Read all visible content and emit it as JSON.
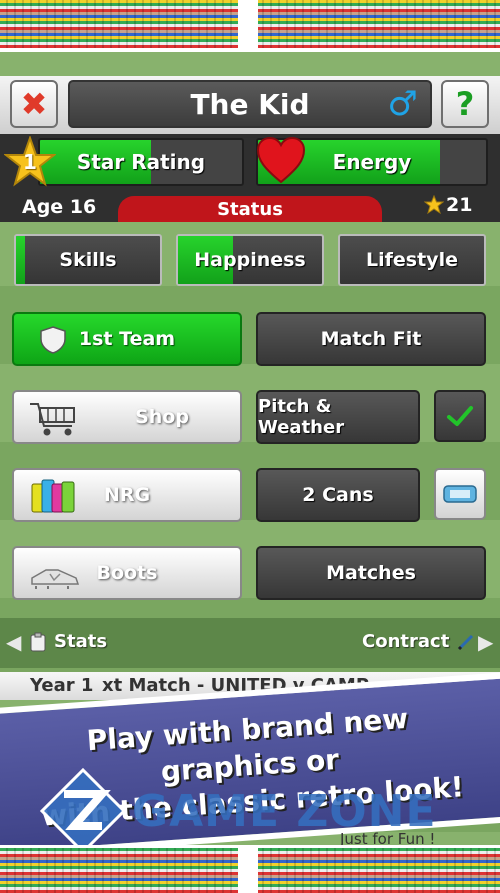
{
  "header": {
    "player_name": "The Kid",
    "gender_symbol": "♂",
    "close_symbol": "✖",
    "help_symbol": "?"
  },
  "meters": {
    "star_rating": {
      "label": "Star Rating",
      "level": 1,
      "fill": 0.55
    },
    "energy": {
      "label": "Energy",
      "fill": 0.8
    }
  },
  "status": {
    "age": "Age 16",
    "tab_label": "Status",
    "stars": "21"
  },
  "tabs": [
    {
      "label": "Skills",
      "fill": 0.06
    },
    {
      "label": "Happiness",
      "fill": 0.38
    },
    {
      "label": "Lifestyle",
      "fill": 0
    }
  ],
  "actions": {
    "first_team": "1st Team",
    "match_fit": "Match Fit",
    "shop": "Shop",
    "pitch_weather": "Pitch & Weather",
    "nrg": "NRG",
    "cans": "2 Cans",
    "boots": "Boots",
    "matches": "Matches"
  },
  "nav": {
    "stats": "Stats",
    "contract": "Contract"
  },
  "info": {
    "year": "Year 1",
    "next_match": "xt Match - UNITED v CAMP"
  },
  "promo": {
    "line1": "Play with brand new graphics or",
    "line2": "with the classic retro look!"
  },
  "watermark": {
    "brand": "GAME ZONE",
    "tagline": "Just for Fun !"
  },
  "colors": {
    "accent_green": "#1bbd21",
    "status_red": "#c0151b",
    "gender_blue": "#1fa3e6"
  }
}
